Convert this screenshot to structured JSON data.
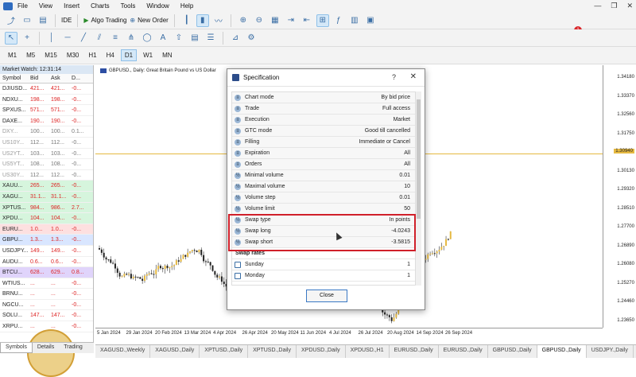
{
  "menu": {
    "items": [
      "File",
      "View",
      "Insert",
      "Charts",
      "Tools",
      "Window",
      "Help"
    ]
  },
  "toolbar": {
    "ide_label": "IDE",
    "algo_label": "Algo Trading",
    "neworder_label": "New Order",
    "notif_count": "1"
  },
  "timeframes": [
    "M1",
    "M5",
    "M15",
    "M30",
    "H1",
    "H4",
    "D1",
    "W1",
    "MN"
  ],
  "timeframes_active": "D1",
  "market_watch": {
    "title": "Market Watch: 12:31:14",
    "headers": [
      "Symbol",
      "Bid",
      "Ask",
      "D..."
    ],
    "rows": [
      {
        "s": "DJIUSD...",
        "b": "421...",
        "a": "421...",
        "d": "-0..."
      },
      {
        "s": "NDXU...",
        "b": "198...",
        "a": "198...",
        "d": "-0..."
      },
      {
        "s": "SPXUS...",
        "b": "571...",
        "a": "571...",
        "d": "-0..."
      },
      {
        "s": "DAXE...",
        "b": "190...",
        "a": "190...",
        "d": "-0..."
      },
      {
        "s": "DXY...",
        "b": "100...",
        "a": "100...",
        "d": "0.1..."
      },
      {
        "s": "US10Y...",
        "b": "112...",
        "a": "112...",
        "d": "-0..."
      },
      {
        "s": "US2YT...",
        "b": "103...",
        "a": "103...",
        "d": "-0..."
      },
      {
        "s": "US5YT...",
        "b": "108...",
        "a": "108...",
        "d": "-0..."
      },
      {
        "s": "US30Y...",
        "b": "112...",
        "a": "112...",
        "d": "-0..."
      },
      {
        "s": "XAUU...",
        "b": "265...",
        "a": "265...",
        "d": "-0..."
      },
      {
        "s": "XAGU...",
        "b": "31.1...",
        "a": "31.1...",
        "d": "-0..."
      },
      {
        "s": "XPTUS...",
        "b": "984...",
        "a": "986...",
        "d": "2.7..."
      },
      {
        "s": "XPDU...",
        "b": "104...",
        "a": "104...",
        "d": "-0..."
      },
      {
        "s": "EURU...",
        "b": "1.0...",
        "a": "1.0...",
        "d": "-0..."
      },
      {
        "s": "GBPU...",
        "b": "1.3...",
        "a": "1.3...",
        "d": "-0..."
      },
      {
        "s": "USDJPY...",
        "b": "149...",
        "a": "149...",
        "d": "-0..."
      },
      {
        "s": "AUDU...",
        "b": "0.6...",
        "a": "0.6...",
        "d": "-0..."
      },
      {
        "s": "BTCU...",
        "b": "628...",
        "a": "629...",
        "d": "0.8..."
      },
      {
        "s": "WTIUS...",
        "b": "...",
        "a": "...",
        "d": "-0..."
      },
      {
        "s": "BRNU...",
        "b": "...",
        "a": "...",
        "d": "-0..."
      },
      {
        "s": "NGCU...",
        "b": "...",
        "a": "...",
        "d": "-0..."
      },
      {
        "s": "SOLU...",
        "b": "147...",
        "a": "147...",
        "d": "-0..."
      },
      {
        "s": "XRPU...",
        "b": "...",
        "a": "...",
        "d": "-0..."
      }
    ],
    "tabs": [
      "Symbols",
      "Details",
      "Trading"
    ]
  },
  "chart": {
    "title": "GBPUSD., Daily: Great Britain Pound vs US Dollar",
    "y_ticks": [
      "1.34180",
      "1.33370",
      "1.32560",
      "1.31750",
      "1.30940",
      "1.30130",
      "1.29320",
      "1.28510",
      "1.27700",
      "1.26890",
      "1.26080",
      "1.25270",
      "1.24460",
      "1.23650"
    ],
    "price_label": "1.30940",
    "x_ticks": [
      "5 Jan 2024",
      "29 Jan 2024",
      "20 Feb 2024",
      "13 Mar 2024",
      "4 Apr 2024",
      "26 Apr 2024",
      "20 May 2024",
      "11 Jun 2024",
      "4 Jul 2024",
      "26 Jul 2024",
      "20 Aug 2024",
      "14 Sep 2024",
      "26 Sep 2024"
    ],
    "up_color": "#e6b941",
    "down_color": "#222222"
  },
  "bottom_tabs": [
    "XAGUSD.,Weekly",
    "XAGUSD.,Daily",
    "XPTUSD.,Daily",
    "XPTUSD.,Daily",
    "XPDUSD.,Daily",
    "XPDUSD.,H1",
    "EURUSD.,Daily",
    "EURUSD.,Daily",
    "GBPUSD.,Daily",
    "GBPUSD.,Daily",
    "USDJPY.,Daily"
  ],
  "bottom_tab_active": 9,
  "dialog": {
    "title": "Specification",
    "help": "?",
    "close_x": "✕",
    "rows": [
      {
        "n": "Chart mode",
        "v": "By bid price"
      },
      {
        "n": "Trade",
        "v": "Full access"
      },
      {
        "n": "Execution",
        "v": "Market"
      },
      {
        "n": "GTC mode",
        "v": "Good till cancelled"
      },
      {
        "n": "Filling",
        "v": "Immediate or Cancel"
      },
      {
        "n": "Expiration",
        "v": "All"
      },
      {
        "n": "Orders",
        "v": "All"
      },
      {
        "n": "Minimal volume",
        "v": "0.01"
      },
      {
        "n": "Maximal volume",
        "v": "10"
      },
      {
        "n": "Volume step",
        "v": "0.01"
      },
      {
        "n": "Volume limit",
        "v": "50"
      },
      {
        "n": "Swap type",
        "v": "In points"
      },
      {
        "n": "Swap long",
        "v": "-4.0243"
      },
      {
        "n": "Swap short",
        "v": "-3.5815"
      }
    ],
    "section": "Swap rates",
    "swap_days": [
      {
        "n": "Sunday",
        "v": "1"
      },
      {
        "n": "Monday",
        "v": "1"
      }
    ],
    "close_button": "Close"
  }
}
